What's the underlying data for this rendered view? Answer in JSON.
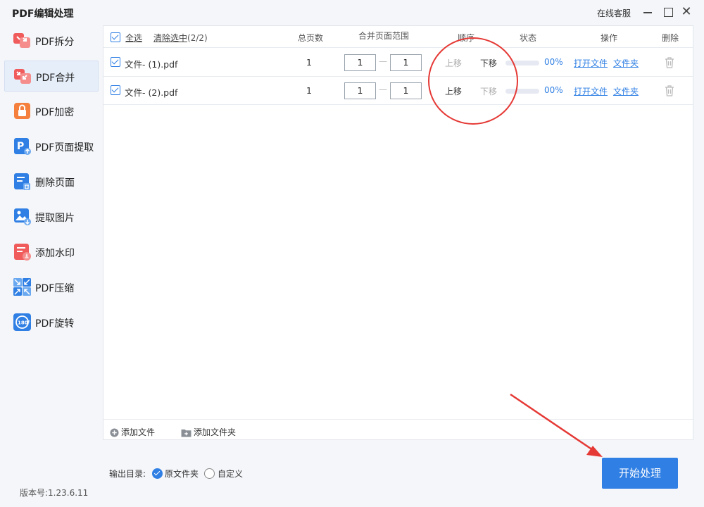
{
  "window": {
    "title": "PDF编辑处理",
    "support_label": "在线客服",
    "close_glyph": "✕"
  },
  "sidebar": {
    "items": [
      {
        "label": "PDF拆分",
        "icon": "split-icon",
        "color": "#f05b5b"
      },
      {
        "label": "PDF合并",
        "icon": "merge-icon",
        "color": "#f05b5b",
        "active": true
      },
      {
        "label": "PDF加密",
        "icon": "lock-icon",
        "color": "#f5803e"
      },
      {
        "label": "PDF页面提取",
        "icon": "page-extract-icon",
        "color": "#2f7fe4"
      },
      {
        "label": "删除页面",
        "icon": "delete-page-icon",
        "color": "#2f7fe4"
      },
      {
        "label": "提取图片",
        "icon": "image-extract-icon",
        "color": "#2f7fe4"
      },
      {
        "label": "添加水印",
        "icon": "watermark-icon",
        "color": "#f05b5b"
      },
      {
        "label": "PDF压缩",
        "icon": "compress-icon",
        "color": "#2f7fe4"
      },
      {
        "label": "PDF旋转",
        "icon": "rotate-icon",
        "color": "#2f7fe4",
        "badge": "180°"
      }
    ],
    "version": "版本号:1.23.6.11"
  },
  "table": {
    "headers": {
      "select_all": "全选",
      "clear_selected": "清除选中",
      "selected_count": "(2/2)",
      "total_pages": "总页数",
      "merge_range": "合并页面范围",
      "order": "顺序",
      "status": "状态",
      "operations": "操作",
      "delete": "删除"
    },
    "rows": [
      {
        "checked": true,
        "filename": "文件- (1).pdf",
        "total_pages": "1",
        "range_from": "1",
        "range_sep": "—",
        "range_to": "1",
        "move_up": "上移",
        "move_up_enabled": false,
        "move_down": "下移",
        "move_down_enabled": true,
        "progress": 0,
        "percent": "00%",
        "open_file": "打开文件",
        "open_folder": "文件夹"
      },
      {
        "checked": true,
        "filename": "文件- (2).pdf",
        "total_pages": "1",
        "range_from": "1",
        "range_sep": "—",
        "range_to": "1",
        "move_up": "上移",
        "move_up_enabled": true,
        "move_down": "下移",
        "move_down_enabled": false,
        "progress": 0,
        "percent": "00%",
        "open_file": "打开文件",
        "open_folder": "文件夹"
      }
    ]
  },
  "footer": {
    "add_file": "添加文件",
    "add_folder": "添加文件夹"
  },
  "output": {
    "label": "输出目录:",
    "option_original": "原文件夹",
    "option_custom": "自定义",
    "selected": "original"
  },
  "start_button": "开始处理",
  "colors": {
    "accent": "#2f7fe4",
    "annotation": "#e53935"
  }
}
